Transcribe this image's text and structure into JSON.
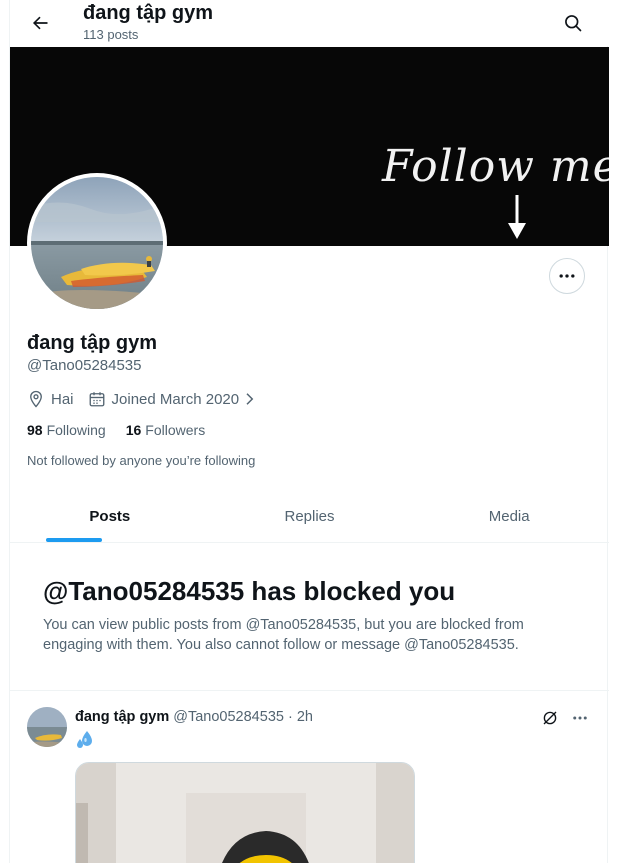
{
  "header": {
    "title": "đang tập gym",
    "post_count": "113 posts",
    "back_icon": "back-arrow-icon",
    "search_icon": "search-icon"
  },
  "banner": {
    "text": "Follow me",
    "arrow_icon": "down-arrow-icon"
  },
  "profile": {
    "display_name": "đang tập gym",
    "handle": "@Tano05284535",
    "location": "Hai",
    "joined": "Joined March 2020",
    "following_count": "98",
    "following_label": "Following",
    "followers_count": "16",
    "followers_label": "Followers",
    "not_followed": "Not followed by anyone you’re following",
    "more_icon": "more-horizontal-icon"
  },
  "tabs": [
    {
      "label": "Posts",
      "active": true
    },
    {
      "label": "Replies",
      "active": false
    },
    {
      "label": "Media",
      "active": false
    }
  ],
  "blocked": {
    "title": "@Tano05284535 has blocked you",
    "message": "You can view public posts from @Tano05284535, but you are blocked from engaging with them. You also cannot follow or message @Tano05284535."
  },
  "post": {
    "name": "đang tập gym",
    "handle_time": "@Tano05284535 · 2h",
    "emoji_icon": "sweat-droplets-icon",
    "action_icons": [
      "grok-icon",
      "more-horizontal-icon"
    ]
  },
  "colors": {
    "accent": "#1d9bf0",
    "text_primary": "#0f1419",
    "text_secondary": "#536471",
    "border": "#eff3f4"
  }
}
